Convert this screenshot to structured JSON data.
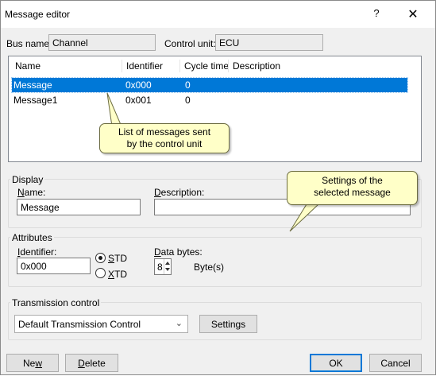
{
  "window": {
    "title": "Message editor",
    "help_label": "?",
    "close_label": "✕"
  },
  "bus": {
    "bus_name_label": "Bus name:",
    "bus_name_value": "Channel",
    "control_unit_label": "Control unit:",
    "control_unit_value": "ECU"
  },
  "list": {
    "columns": [
      "Name",
      "Identifier",
      "Cycle time",
      "Description"
    ],
    "rows": [
      {
        "name": "Message",
        "identifier": "0x000",
        "cycle_time": "0",
        "description": ""
      },
      {
        "name": "Message1",
        "identifier": "0x001",
        "cycle_time": "0",
        "description": ""
      }
    ],
    "selected_index": 0
  },
  "display": {
    "group_title": "Display",
    "name_label": "Name:",
    "name_value": "Message",
    "description_label": "Description:",
    "description_value": ""
  },
  "attributes": {
    "group_title": "Attributes",
    "identifier_label": "Identifier:",
    "identifier_value": "0x000",
    "std_label": "STD",
    "xtd_label": "XTD",
    "selected": "STD",
    "data_bytes_label": "Data bytes:",
    "data_bytes_value": "8",
    "bytes_unit": "Byte(s)"
  },
  "transmission": {
    "group_title": "Transmission control",
    "selected_option": "Default Transmission Control",
    "settings_label": "Settings"
  },
  "footer": {
    "new_label": "New",
    "delete_label": "Delete",
    "ok_label": "OK",
    "cancel_label": "Cancel"
  },
  "annotations": {
    "list_callout_line1": "List of messages sent",
    "list_callout_line2": "by the control unit",
    "settings_callout_line1": "Settings of the",
    "settings_callout_line2": "selected message"
  },
  "colors": {
    "selection": "#0078d7",
    "callout_fill": "#ffffc8",
    "dialog_bg": "#f0f0f0"
  }
}
